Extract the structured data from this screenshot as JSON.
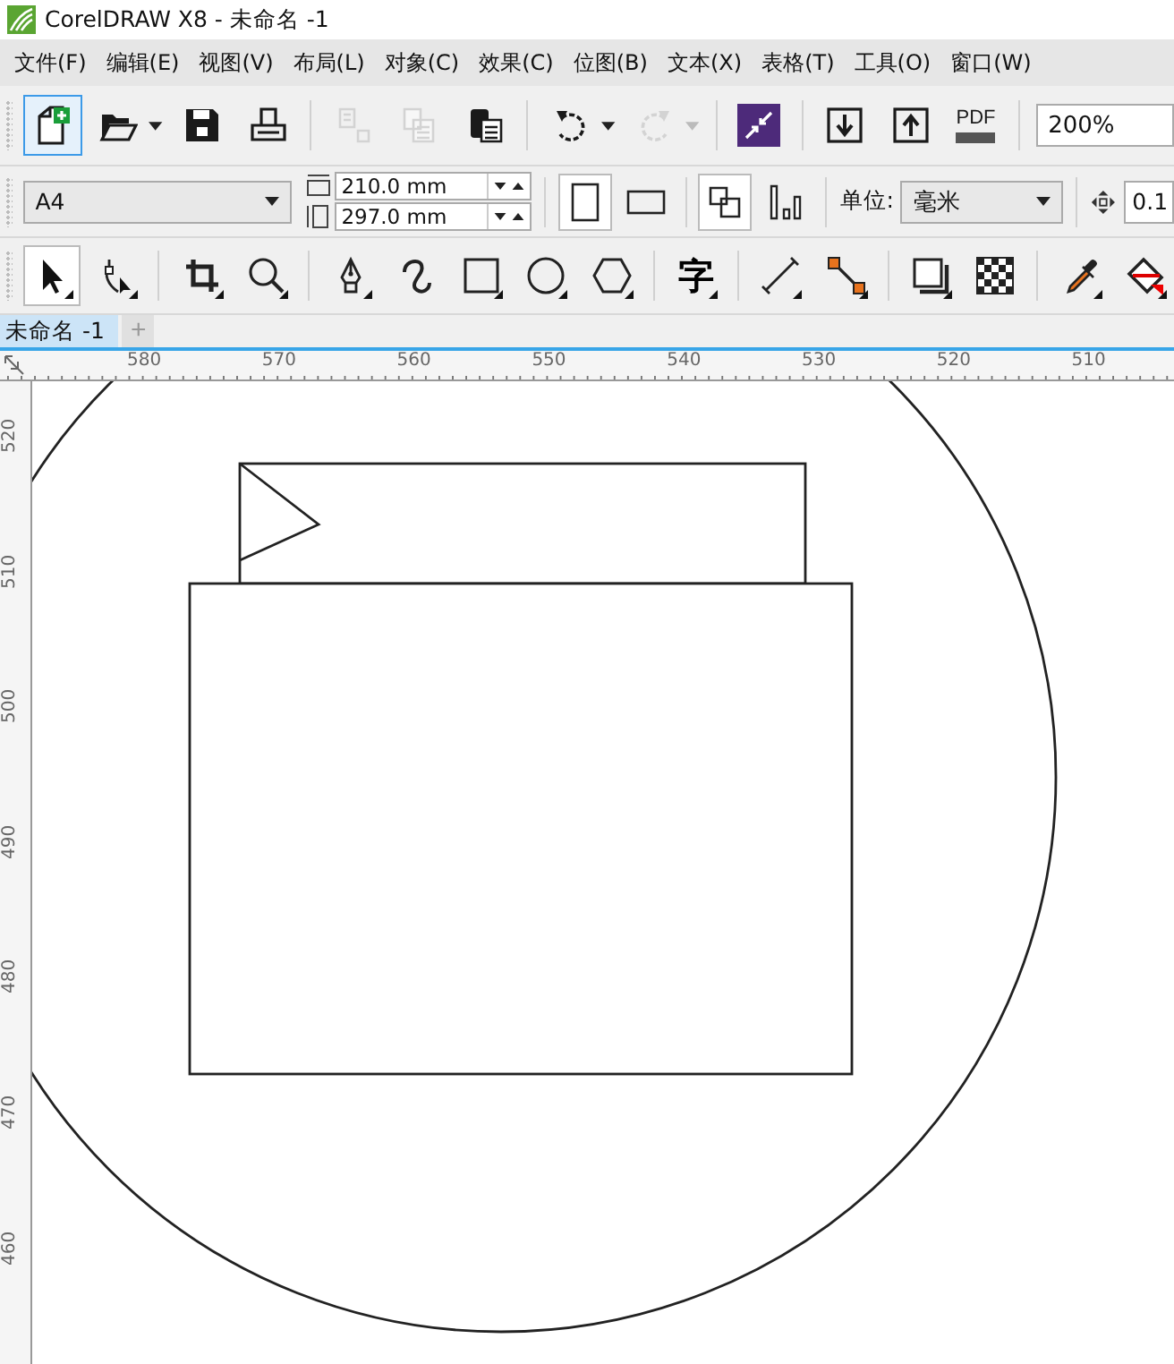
{
  "window": {
    "title": "CorelDRAW X8 - 未命名 -1"
  },
  "menu": [
    "文件(F)",
    "编辑(E)",
    "视图(V)",
    "布局(L)",
    "对象(C)",
    "效果(C)",
    "位图(B)",
    "文本(X)",
    "表格(T)",
    "工具(O)",
    "窗口(W)"
  ],
  "toolbar": {
    "groups": [
      [
        {
          "kind": "new",
          "selected": true,
          "disabled": false
        },
        {
          "kind": "open",
          "selected": false,
          "disabled": false,
          "dropdown": true
        },
        {
          "kind": "save",
          "selected": false,
          "disabled": false
        },
        {
          "kind": "print",
          "selected": false,
          "disabled": false
        }
      ],
      [
        {
          "kind": "cut",
          "selected": false,
          "disabled": true
        },
        {
          "kind": "copy",
          "selected": false,
          "disabled": true
        },
        {
          "kind": "paste",
          "selected": false,
          "disabled": false
        }
      ],
      [
        {
          "kind": "undo",
          "selected": false,
          "disabled": false,
          "dropdown": true
        },
        {
          "kind": "redo",
          "selected": false,
          "disabled": true,
          "dropdown": true
        }
      ],
      [
        {
          "kind": "launcher",
          "selected": false,
          "disabled": false
        }
      ],
      [
        {
          "kind": "import",
          "selected": false,
          "disabled": false
        },
        {
          "kind": "export",
          "selected": false,
          "disabled": false
        },
        {
          "kind": "pdf",
          "label": "PDF",
          "selected": false,
          "disabled": false
        }
      ]
    ],
    "zoom": "200%"
  },
  "property_bar": {
    "page_size": "A4",
    "width": "210.0 mm",
    "height": "297.0 mm",
    "orientation": [
      {
        "kind": "portrait",
        "selected": true
      },
      {
        "kind": "landscape",
        "selected": false
      }
    ],
    "page_layout": [
      {
        "kind": "all-pages",
        "selected": true
      },
      {
        "kind": "current-page",
        "selected": false
      }
    ],
    "unit_label": "单位:",
    "unit": "毫米",
    "nudge": "0.1"
  },
  "toolbox": [
    [
      {
        "kind": "pick",
        "selected": true,
        "flyout": true
      },
      {
        "kind": "shape",
        "selected": false,
        "flyout": true
      }
    ],
    [
      {
        "kind": "crop",
        "selected": false,
        "flyout": true
      },
      {
        "kind": "zoom",
        "selected": false,
        "flyout": true
      }
    ],
    [
      {
        "kind": "pen",
        "selected": false,
        "flyout": true
      },
      {
        "kind": "curve",
        "selected": false,
        "flyout": false
      },
      {
        "kind": "rectangle",
        "selected": false,
        "flyout": true
      },
      {
        "kind": "ellipse",
        "selected": false,
        "flyout": true
      },
      {
        "kind": "polygon",
        "selected": false,
        "flyout": true
      }
    ],
    [
      {
        "kind": "text",
        "glyph": "字",
        "selected": false,
        "flyout": true
      }
    ],
    [
      {
        "kind": "dimension",
        "selected": false,
        "flyout": true
      },
      {
        "kind": "connector",
        "selected": false,
        "flyout": true
      }
    ],
    [
      {
        "kind": "shadow",
        "selected": false,
        "flyout": true
      },
      {
        "kind": "transparency",
        "selected": false,
        "flyout": false
      }
    ],
    [
      {
        "kind": "eyedropper",
        "selected": false,
        "flyout": true
      },
      {
        "kind": "fill",
        "selected": false,
        "flyout": true
      }
    ]
  ],
  "document_tabs": [
    {
      "label": "未命名 -1",
      "selected": true
    }
  ],
  "new_tab_button": "+",
  "rulers": {
    "horizontal": [
      "580",
      "570",
      "560",
      "550",
      "540",
      "530",
      "520",
      "510"
    ],
    "vertical": [
      "520",
      "510",
      "500",
      "490",
      "480",
      "470",
      "460"
    ]
  }
}
